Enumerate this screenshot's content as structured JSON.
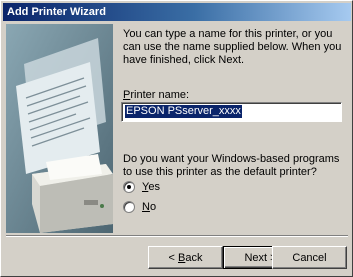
{
  "window": {
    "title": "Add Printer Wizard"
  },
  "intro": {
    "text": "You can type a name for this printer, or you can use the name supplied below. When you have finished, click Next."
  },
  "printer_name": {
    "label_hotkey": "P",
    "label_rest": "rinter name:",
    "value": "EPSON PSserver_xxxx"
  },
  "default_question": {
    "text": "Do you want your Windows-based programs to use this printer as the default printer?"
  },
  "radios": {
    "yes": {
      "hotkey": "Y",
      "rest": "es",
      "selected": true
    },
    "no": {
      "hotkey": "N",
      "rest": "o",
      "selected": false
    }
  },
  "buttons": {
    "back": {
      "prefix": "< ",
      "hotkey": "B",
      "rest": "ack"
    },
    "next": {
      "label": "Next >"
    },
    "cancel": {
      "label": "Cancel"
    }
  }
}
